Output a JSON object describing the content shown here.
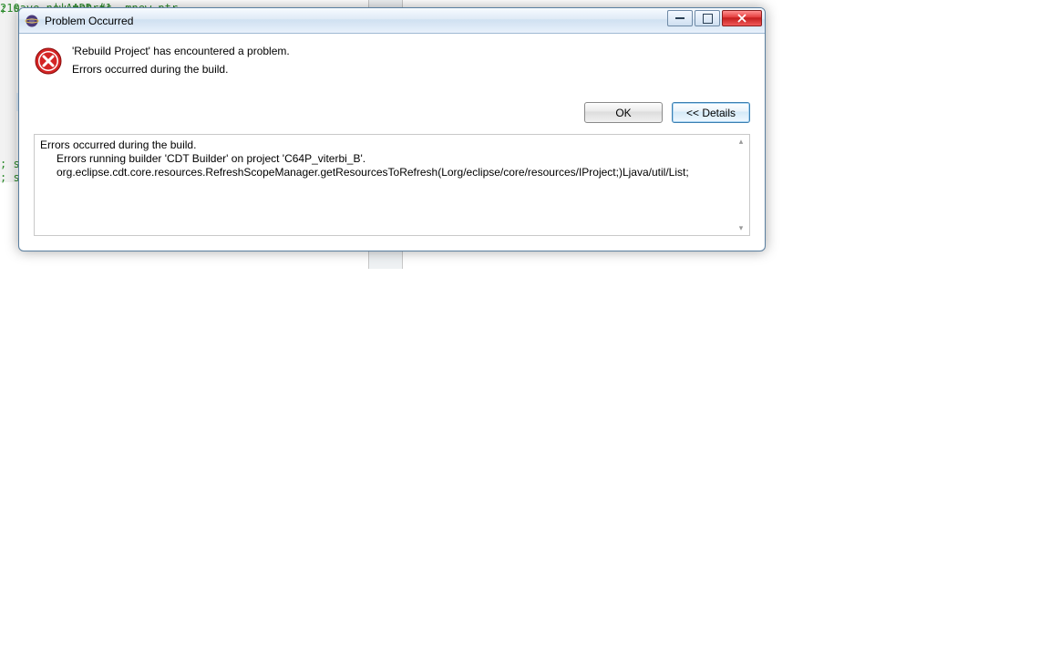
{
  "bg_code": {
    "line1": "; save new metric",
    "line2": "; sa",
    "line3": "; sa",
    "disasm": "210     ||AADD #1, mnew ptr"
  },
  "dialog": {
    "title": "Problem Occurred",
    "message_line1": "'Rebuild Project' has encountered a problem.",
    "message_line2": "Errors occurred during the build.",
    "ok_label": "OK",
    "details_label": "<< Details",
    "details_text": {
      "l1": "Errors occurred during the build.",
      "l2": "Errors running builder 'CDT Builder' on project 'C64P_viterbi_B'.",
      "l3": "org.eclipse.cdt.core.resources.RefreshScopeManager.getResourcesToRefresh(Lorg/eclipse/core/resources/IProject;)Ljava/util/List;"
    }
  }
}
